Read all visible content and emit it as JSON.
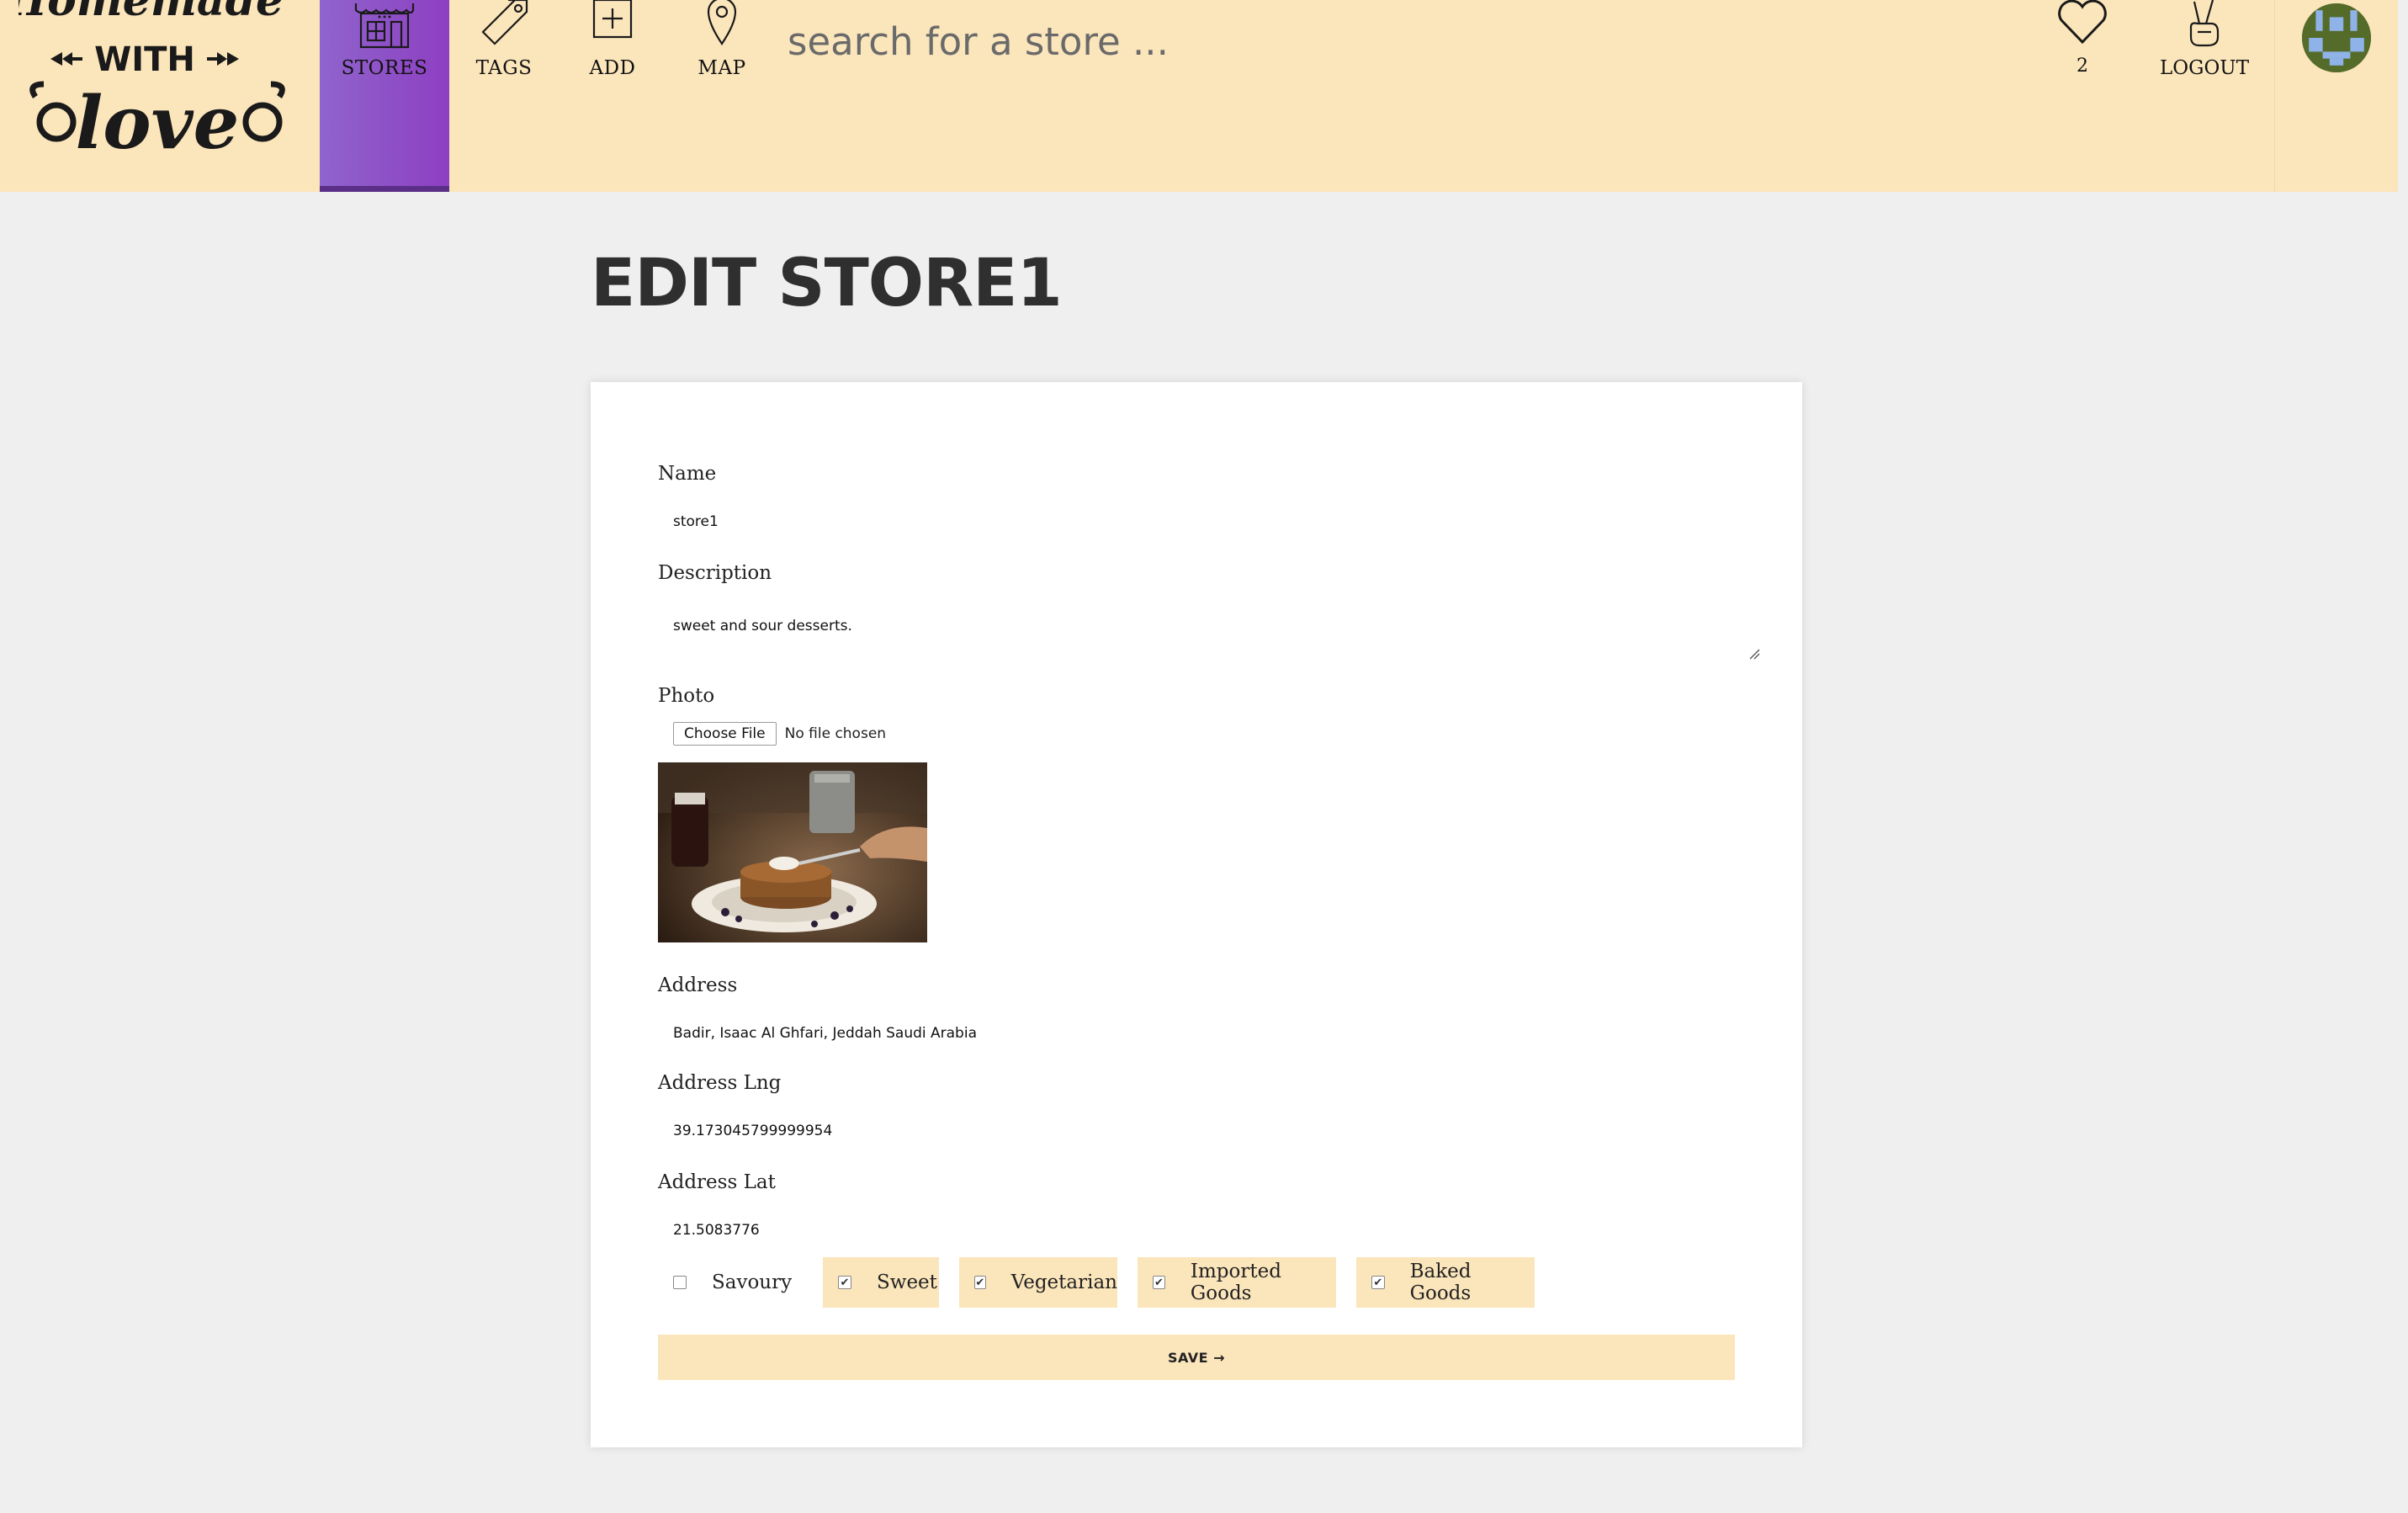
{
  "header": {
    "logo_text": [
      "Homemade",
      "WITH",
      "love"
    ],
    "nav": {
      "stores": "STORES",
      "tags": "TAGS",
      "add": "ADD",
      "map": "MAP"
    },
    "search_placeholder": "search for a store ...",
    "hearts_count": "2",
    "logout": "LOGOUT"
  },
  "page": {
    "title": "Edit store1"
  },
  "form": {
    "name_label": "Name",
    "name_value": "store1",
    "description_label": "Description",
    "description_value": "sweet and sour desserts.",
    "photo_label": "Photo",
    "file_button": "Choose File",
    "file_status": "No file chosen",
    "address_label": "Address",
    "address_value": "Badir, Isaac Al Ghfari, Jeddah Saudi Arabia",
    "lng_label": "Address Lng",
    "lng_value": "39.173045799999954",
    "lat_label": "Address Lat",
    "lat_value": "21.5083776",
    "tags": [
      {
        "label": "Savoury",
        "checked": false
      },
      {
        "label": "Sweet",
        "checked": true
      },
      {
        "label": "Vegetarian",
        "checked": true
      },
      {
        "label": "Imported Goods",
        "checked": true
      },
      {
        "label": "Baked Goods",
        "checked": true
      }
    ],
    "save_label": "SAVE →"
  },
  "colors": {
    "header_bg": "#fbe5bb",
    "active_nav": "#8e4fc4",
    "page_bg": "#efefef",
    "card_bg": "#ffffff"
  }
}
